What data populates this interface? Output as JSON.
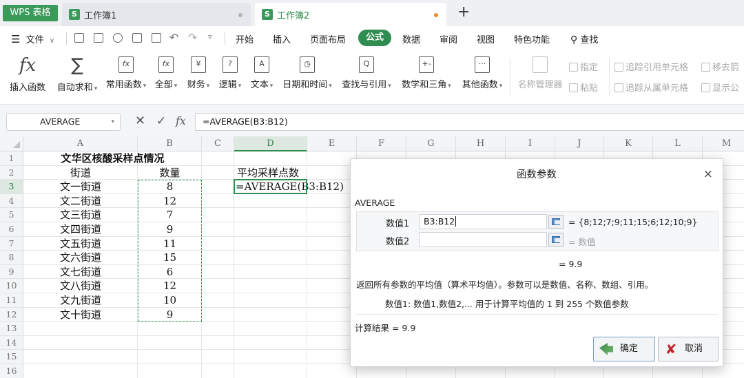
{
  "app": {
    "name": "WPS 表格"
  },
  "tabs": [
    {
      "logo": "S",
      "label": "工作簿1"
    },
    {
      "logo": "S",
      "label": "工作簿2"
    }
  ],
  "menu": {
    "file": "文件",
    "items": [
      "开始",
      "插入",
      "页面布局",
      "公式",
      "数据",
      "审阅",
      "视图",
      "特色功能"
    ],
    "active": "公式",
    "search": "查找"
  },
  "ribbon": {
    "buttons": [
      {
        "icon": "fx",
        "label": "插入函数"
      },
      {
        "icon": "Σ",
        "label": "自动求和"
      },
      {
        "icon": "fx",
        "label": "常用函数"
      },
      {
        "icon": "fx",
        "label": "全部"
      },
      {
        "icon": "¥",
        "label": "财务"
      },
      {
        "icon": "?",
        "label": "逻辑"
      },
      {
        "icon": "A",
        "label": "文本"
      },
      {
        "icon": "◷",
        "label": "日期和时间"
      },
      {
        "icon": "Q",
        "label": "查找与引用"
      },
      {
        "icon": "+-",
        "label": "数学和三角"
      },
      {
        "icon": "···",
        "label": "其他函数"
      }
    ],
    "name_manager": "名称管理器",
    "specify": "指定",
    "paste": "粘贴",
    "trace_precedents": "追踪引用单元格",
    "trace_dependents": "追踪从属单元格",
    "remove_arrows": "移去箭",
    "show_formula": "显示公"
  },
  "formula_bar": {
    "name_box": "AVERAGE",
    "formula": "=AVERAGE(B3:B12)"
  },
  "sheet": {
    "columns": [
      "A",
      "B",
      "C",
      "D",
      "E",
      "F",
      "G",
      "H",
      "I",
      "J",
      "K",
      "L",
      "M"
    ],
    "rows": [
      "1",
      "2",
      "3",
      "4",
      "5",
      "6",
      "7",
      "8",
      "9",
      "10",
      "11",
      "12",
      "13",
      "14",
      "15",
      "16"
    ],
    "title": "文华区核酸采样点情况",
    "header_street": "街道",
    "header_count": "数量",
    "header_avg": "平均采样点数",
    "active_formula": "=AVERAGE(B3:B12)",
    "records": [
      {
        "street": "文一街道",
        "count": "8"
      },
      {
        "street": "文二街道",
        "count": "12"
      },
      {
        "street": "文三街道",
        "count": "7"
      },
      {
        "street": "文四街道",
        "count": "9"
      },
      {
        "street": "文五街道",
        "count": "11"
      },
      {
        "street": "文六街道",
        "count": "15"
      },
      {
        "street": "文七街道",
        "count": "6"
      },
      {
        "street": "文八街道",
        "count": "12"
      },
      {
        "street": "文九街道",
        "count": "10"
      },
      {
        "street": "文十街道",
        "count": "9"
      }
    ]
  },
  "dialog": {
    "title": "函数参数",
    "close": "×",
    "function_name": "AVERAGE",
    "arg1_label": "数值1",
    "arg1_value": "B3:B12",
    "arg1_result": "= {8;12;7;9;11;15;6;12;10;9}",
    "arg2_label": "数值2",
    "arg2_value": "",
    "arg2_result": "= 数值",
    "equals": "= 9.9",
    "description": "返回所有参数的平均值（算术平均值）。参数可以是数值、名称、数组、引用。",
    "arg_description": "数值1:  数值1,数值2,... 用于计算平均值的 1 到 255 个数值参数",
    "result": "计算结果 = 9.9",
    "ok": "确定",
    "cancel": "取消"
  }
}
